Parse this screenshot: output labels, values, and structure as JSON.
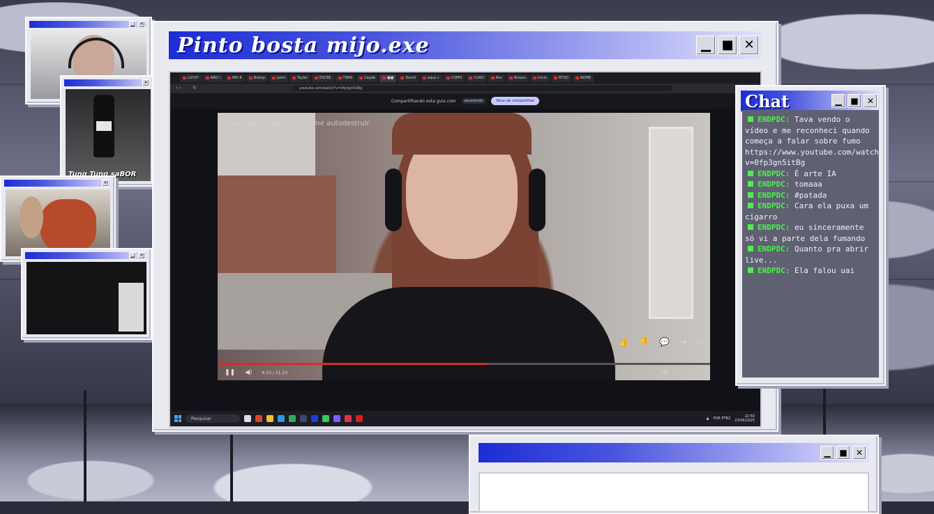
{
  "main_window": {
    "title": "Pinto bosta mijo.exe",
    "buttons": {
      "minimize": "▁",
      "maximize": "■",
      "close": "✕"
    }
  },
  "browser": {
    "tabs": [
      "LUCKY",
      "NÃO I",
      "Will K",
      "Bratsp",
      "Jaimi",
      "Taylor",
      "ESCRE",
      "TRAN",
      "Capab",
      "■■",
      "Devid",
      "aqua c",
      "COMO",
      "CUAD",
      "Ros",
      "Amazo",
      "Início",
      "BTUD",
      "NOME"
    ],
    "url": "youtube.com/watch?v=0fp3gn5itBg",
    "share_text": "Compartilhando esta guia com",
    "share_chip": "aoussendo",
    "share_button": "Parar de compartilhar"
  },
  "video": {
    "caption": "me destraindo pro não me autodestruir",
    "time": "6:10 / 11:23",
    "progress": 0.55
  },
  "taskbar": {
    "search": "Pesquisar",
    "lang": "POR PTB2",
    "time": "22:50",
    "date": "23/06/2025"
  },
  "chat": {
    "title": "Chat",
    "messages": [
      {
        "user": "ENDPDC:",
        "text": "Tava vendo o vídeo e me reconheci quando começa a falar sobre fumo https://www.youtube.com/watch?v=0fp3gn5itBg"
      },
      {
        "user": "ENDPDC:",
        "text": "É arte IA"
      },
      {
        "user": "ENDPDC:",
        "text": "tomaaa"
      },
      {
        "user": "ENDPDC:",
        "text": "#patada"
      },
      {
        "user": "ENDPDC:",
        "text": "Cara ela puxa um cigarro"
      },
      {
        "user": "ENDPDC:",
        "text": "eu sinceramente só vi a parte dela fumando"
      },
      {
        "user": "ENDPDC:",
        "text": "Quanto pra abrir live..."
      },
      {
        "user": "ENDPDC:",
        "text": "Ela falou uai"
      }
    ]
  },
  "cams": {
    "cam2_label": "Tung Tung saBOR"
  },
  "colors": {
    "titlebar": "#1d2cd6",
    "chat_user": "#4cf04a",
    "chat_bg": "#5f6172"
  }
}
